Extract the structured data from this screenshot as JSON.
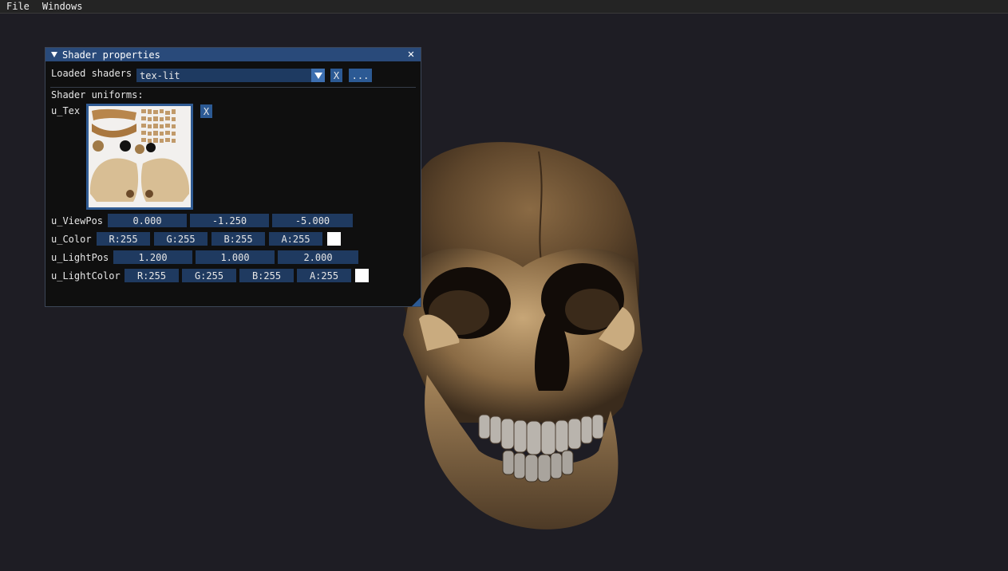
{
  "menubar": {
    "items": [
      "File",
      "Windows"
    ]
  },
  "window": {
    "title": "Shader properties",
    "loaded_shaders_label": "Loaded shaders",
    "selected_shader": "tex-lit",
    "remove_shader_label": "X",
    "more_label": "...",
    "uniforms_heading": "Shader uniforms:",
    "u_tex": {
      "name": "u_Tex",
      "clear_label": "X"
    },
    "u_viewpos": {
      "name": "u_ViewPos",
      "values": [
        "0.000",
        "-1.250",
        "-5.000"
      ]
    },
    "u_color": {
      "name": "u_Color",
      "values": [
        "R:255",
        "G:255",
        "B:255",
        "A:255"
      ],
      "swatch": "#ffffff"
    },
    "u_lightpos": {
      "name": "u_LightPos",
      "values": [
        "1.200",
        "1.000",
        "2.000"
      ]
    },
    "u_lightcolor": {
      "name": "u_LightColor",
      "values": [
        "R:255",
        "G:255",
        "B:255",
        "A:255"
      ],
      "swatch": "#ffffff"
    }
  },
  "colors": {
    "background": "#1e1d24",
    "title_bar": "#294a7a",
    "frame": "#1f3a60",
    "button": "#2c5a94",
    "bone": "#b08a58"
  }
}
